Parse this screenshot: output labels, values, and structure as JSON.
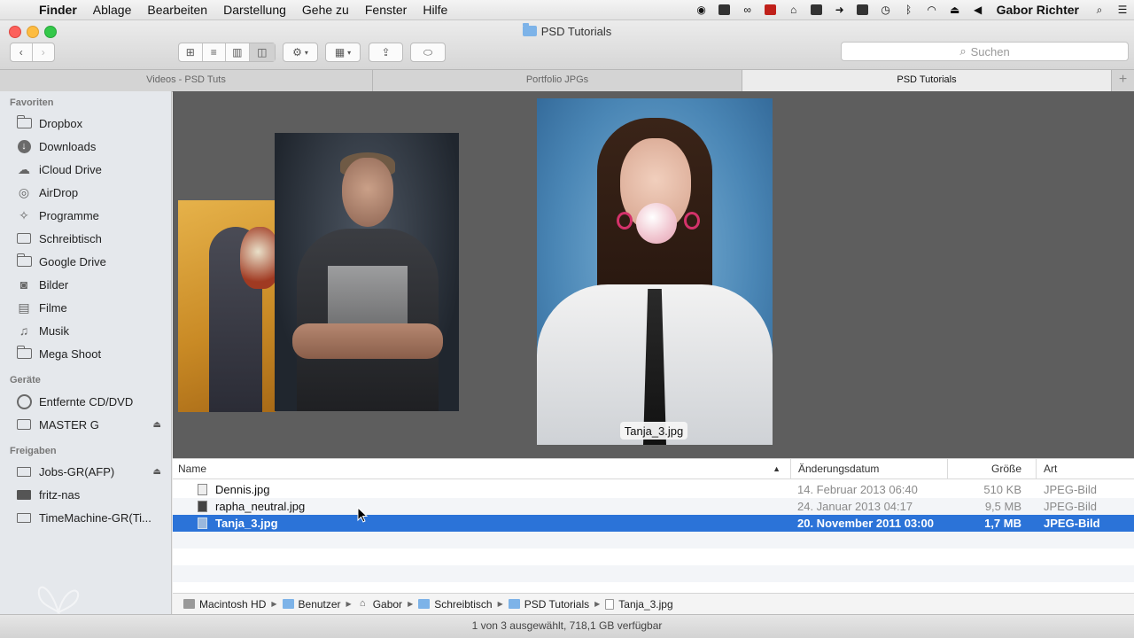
{
  "menubar": {
    "apple_glyph": "",
    "items": [
      "Finder",
      "Ablage",
      "Bearbeiten",
      "Darstellung",
      "Gehe zu",
      "Fenster",
      "Hilfe"
    ],
    "user": "Gabor Richter"
  },
  "window": {
    "title": "PSD Tutorials"
  },
  "search": {
    "placeholder": "Suchen"
  },
  "tabs": [
    "Videos - PSD Tuts",
    "Portfolio JPGs",
    "PSD Tutorials"
  ],
  "tab_add": "+",
  "sidebar": {
    "favorites_header": "Favoriten",
    "favorites": [
      "Dropbox",
      "Downloads",
      "iCloud Drive",
      "AirDrop",
      "Programme",
      "Schreibtisch",
      "Google Drive",
      "Bilder",
      "Filme",
      "Musik",
      "Mega Shoot"
    ],
    "devices_header": "Geräte",
    "devices": [
      "Entfernte CD/DVD",
      "MASTER G"
    ],
    "shared_header": "Freigaben",
    "shared": [
      "Jobs-GR(AFP)",
      "fritz-nas",
      "TimeMachine-GR(Ti..."
    ]
  },
  "coverflow": {
    "selected_label": "Tanja_3.jpg"
  },
  "list": {
    "columns": {
      "name": "Name",
      "date": "Änderungsdatum",
      "size": "Größe",
      "kind": "Art"
    },
    "rows": [
      {
        "name": "Dennis.jpg",
        "date": "14. Februar 2013 06:40",
        "size": "510 KB",
        "kind": "JPEG-Bild"
      },
      {
        "name": "rapha_neutral.jpg",
        "date": "24. Januar 2013 04:17",
        "size": "9,5 MB",
        "kind": "JPEG-Bild"
      },
      {
        "name": "Tanja_3.jpg",
        "date": "20. November 2011 03:00",
        "size": "1,7 MB",
        "kind": "JPEG-Bild"
      }
    ]
  },
  "pathbar": [
    "Macintosh HD",
    "Benutzer",
    "Gabor",
    "Schreibtisch",
    "PSD Tutorials",
    "Tanja_3.jpg"
  ],
  "status": "1 von 3 ausgewählt, 718,1 GB verfügbar",
  "colors": {
    "selection": "#2b73d8",
    "sidebar_bg": "#e5e8ec",
    "coverflow_bg": "#5e5e5e"
  }
}
